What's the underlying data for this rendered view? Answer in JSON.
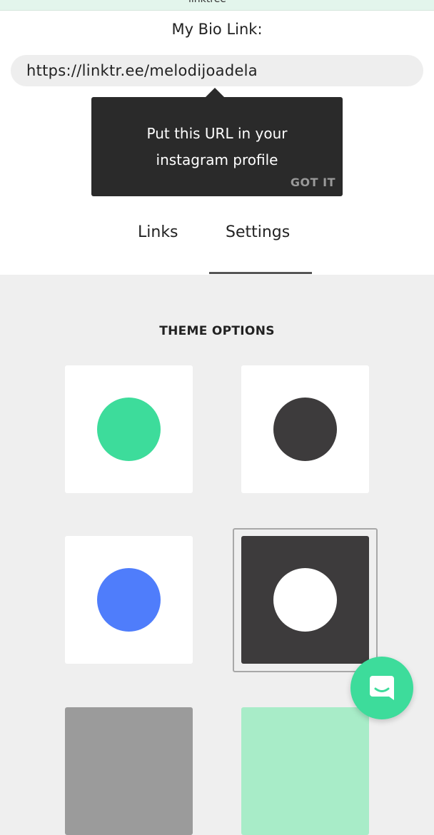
{
  "status_bar": {
    "site": "linktree"
  },
  "bio": {
    "label": "My Bio Link:",
    "url": "https://linktr.ee/melodijoadela"
  },
  "tooltip": {
    "line1": "Put this URL in your",
    "line2": "instagram profile",
    "dismiss_label": "GOT IT"
  },
  "tabs": [
    {
      "label": "Links",
      "active": false
    },
    {
      "label": "Settings",
      "active": true
    }
  ],
  "themes": {
    "title": "THEME OPTIONS",
    "options": [
      {
        "card_color": "#ffffff",
        "dot_color": "#3ddc9b",
        "selected": false
      },
      {
        "card_color": "#ffffff",
        "dot_color": "#3d3b3c",
        "selected": false
      },
      {
        "card_color": "#ffffff",
        "dot_color": "#4f7dfb",
        "selected": false
      },
      {
        "card_color": "#3d3b3c",
        "dot_color": "#ffffff",
        "selected": true
      },
      {
        "card_color": "#9b9b9b",
        "dot_color": "",
        "selected": false
      },
      {
        "card_color": "#a8ecc8",
        "dot_color": "",
        "selected": false
      }
    ]
  },
  "chat": {
    "icon": "chat-bubble-icon",
    "color": "#3ddc9b"
  }
}
